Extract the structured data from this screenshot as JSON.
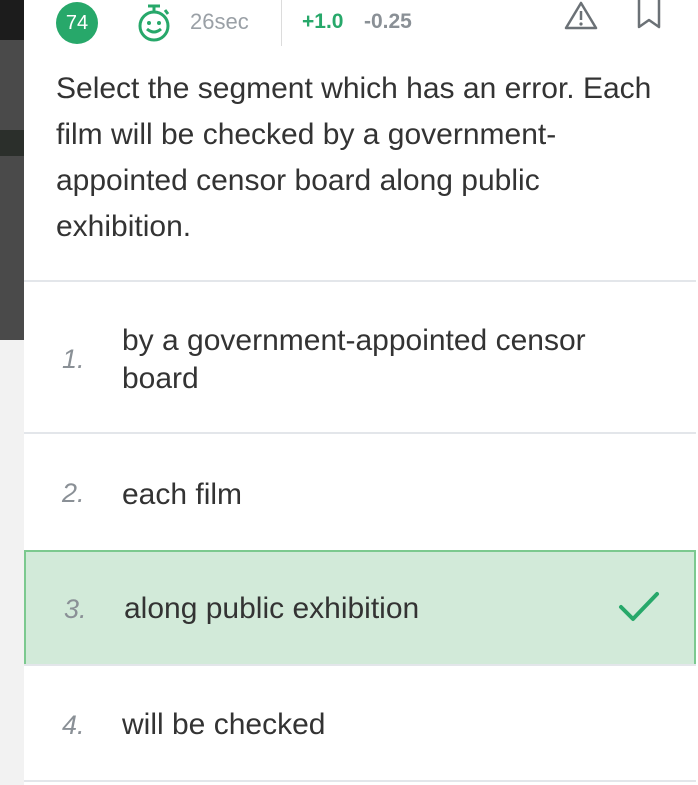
{
  "header": {
    "question_number": "74",
    "time": "26sec",
    "marks_positive": "+1.0",
    "marks_negative": "-0.25"
  },
  "question": {
    "text": "Select the segment which has an error. Each film will be checked by a government-appointed censor board along public exhibition."
  },
  "options": [
    {
      "number": "1.",
      "text": "by a government-appointed censor board",
      "selected": false
    },
    {
      "number": "2.",
      "text": "each film",
      "selected": false
    },
    {
      "number": "3.",
      "text": "along public exhibition",
      "selected": true
    },
    {
      "number": "4.",
      "text": "will be checked",
      "selected": false
    }
  ],
  "icons": {
    "timer": "smiley-timer-icon",
    "report": "warning-icon",
    "bookmark": "bookmark-icon",
    "correct": "check-icon"
  },
  "colors": {
    "accent": "#27a86a",
    "selected_bg": "#d2ead9",
    "selected_border": "#7cc98f"
  }
}
